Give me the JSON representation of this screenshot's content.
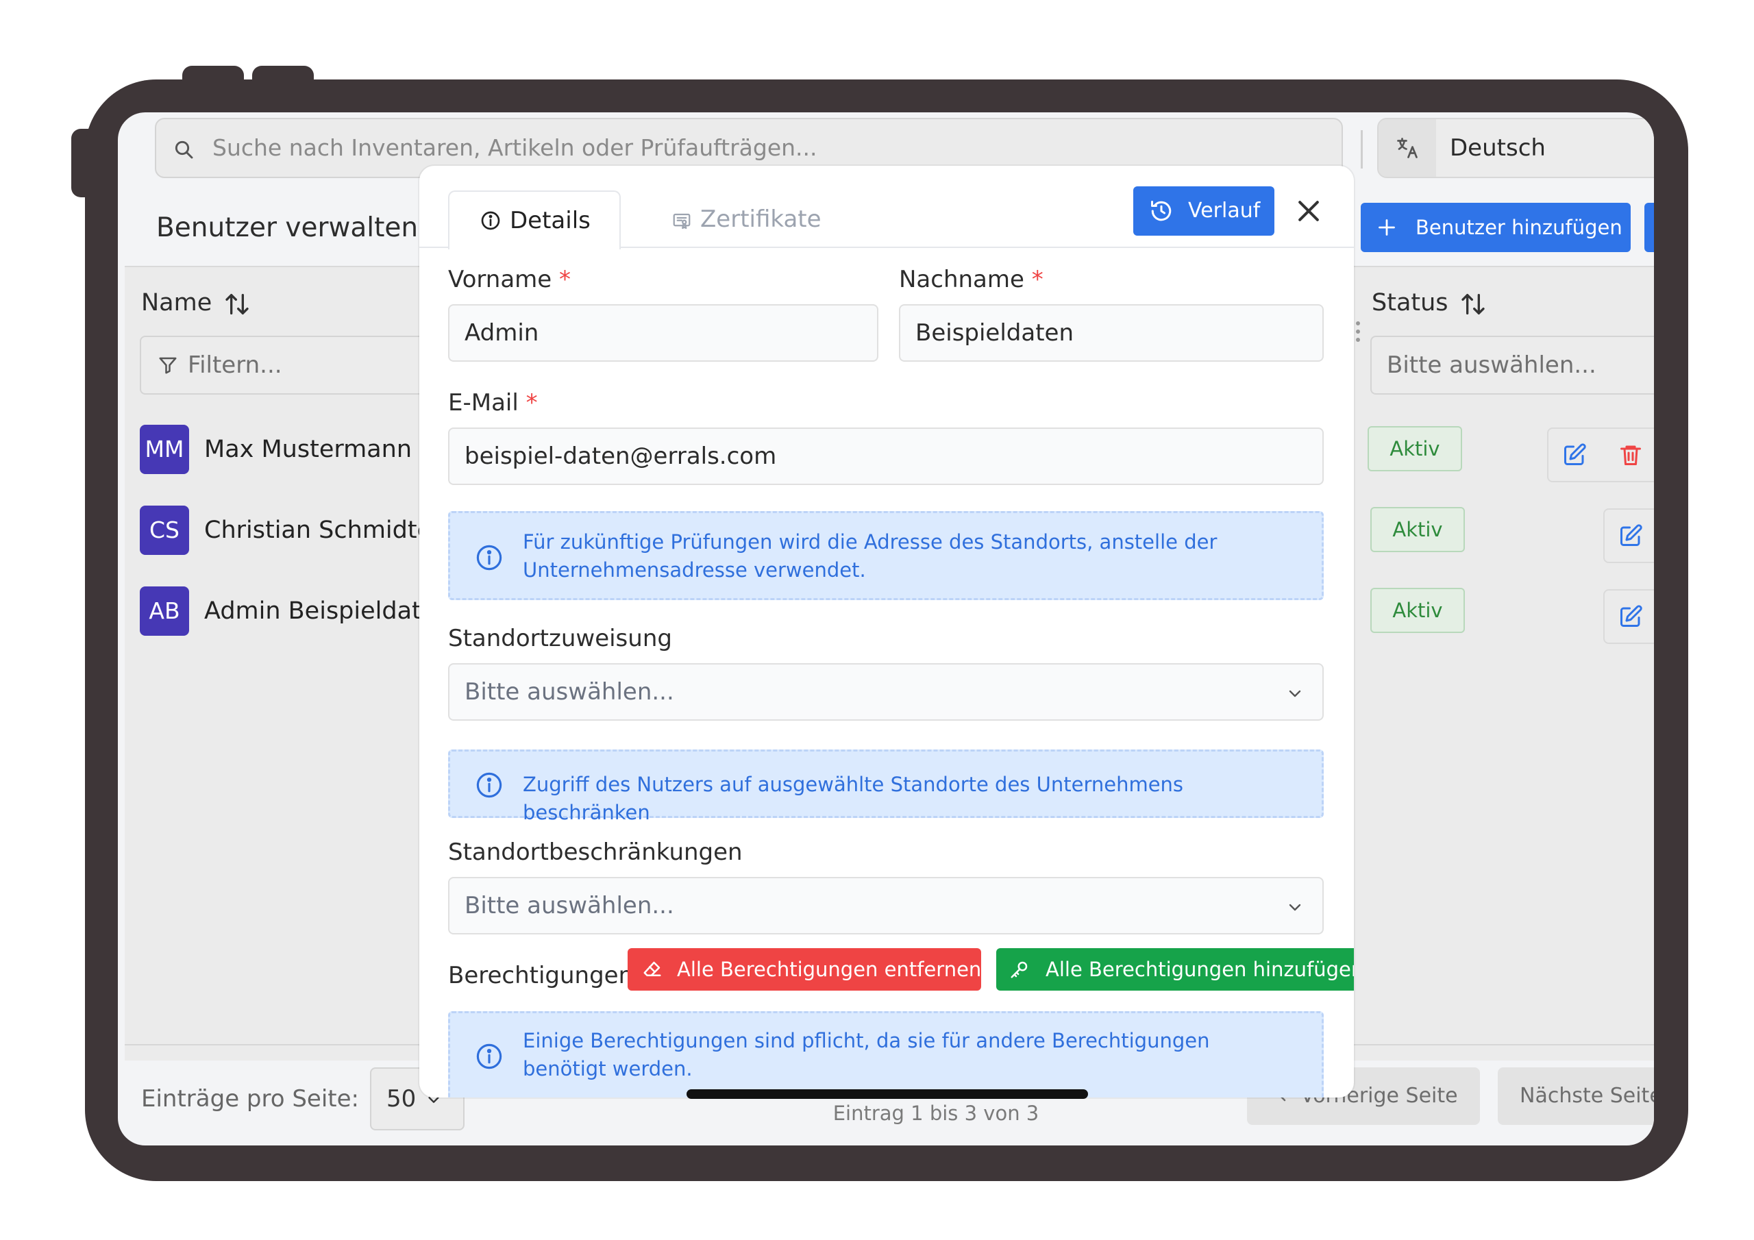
{
  "app": {
    "search_placeholder": "Suche nach Inventaren, Artikeln oder Prüfaufträgen...",
    "language": "Deutsch",
    "page_title": "Benutzer verwalten",
    "add_user_label": "Benutzer hinzufügen"
  },
  "table": {
    "columns": {
      "name": "Name",
      "status": "Status"
    },
    "filter_placeholder": "Filtern...",
    "status_placeholder": "Bitte auswählen...",
    "rows": [
      {
        "initials": "MM",
        "name": "Max Mustermann",
        "status": "Aktiv"
      },
      {
        "initials": "CS",
        "name": "Christian Schmidte",
        "status": "Aktiv"
      },
      {
        "initials": "AB",
        "name": "Admin Beispieldate",
        "status": "Aktiv"
      }
    ]
  },
  "footer": {
    "per_page_label": "Einträge pro Seite:",
    "per_page_value": "50",
    "entries_text": "Eintrag 1 bis 3 von 3",
    "prev_label": "Vorherige Seite",
    "next_label": "Nächste Seite"
  },
  "modal": {
    "tabs": [
      {
        "label": "Details"
      },
      {
        "label": "Zertifikate"
      }
    ],
    "history_label": "Verlauf",
    "fields": {
      "firstname": {
        "label": "Vorname",
        "required": "*",
        "value": "Admin"
      },
      "lastname": {
        "label": "Nachname",
        "required": "*",
        "value": "Beispieldaten"
      },
      "email": {
        "label": "E-Mail",
        "required": "*",
        "value": "beispiel-daten@errals.com"
      },
      "location": {
        "label": "Standortzuweisung",
        "placeholder": "Bitte auswählen..."
      },
      "restrictions": {
        "label": "Standortbeschränkungen",
        "placeholder": "Bitte auswählen..."
      }
    },
    "info": {
      "address": "Für zukünftige Prüfungen wird die Adresse des Standorts, anstelle der Unternehmensadresse verwendet.",
      "restrict": "Zugriff des Nutzers auf ausgewählte Standorte des Unternehmens beschränken",
      "permissions": "Einige Berechtigungen sind pflicht, da sie für andere Berechtigungen benötigt werden."
    },
    "permissions_label": "Berechtigungen",
    "remove_all_label": "Alle Berechtigungen entfernen",
    "add_all_label": "Alle Berechtigungen hinzufügen"
  },
  "colors": {
    "primary": "#2f74e8",
    "danger": "#ef4444",
    "success": "#16a34a",
    "avatar": "#4638b5",
    "frame": "#3e3638"
  }
}
